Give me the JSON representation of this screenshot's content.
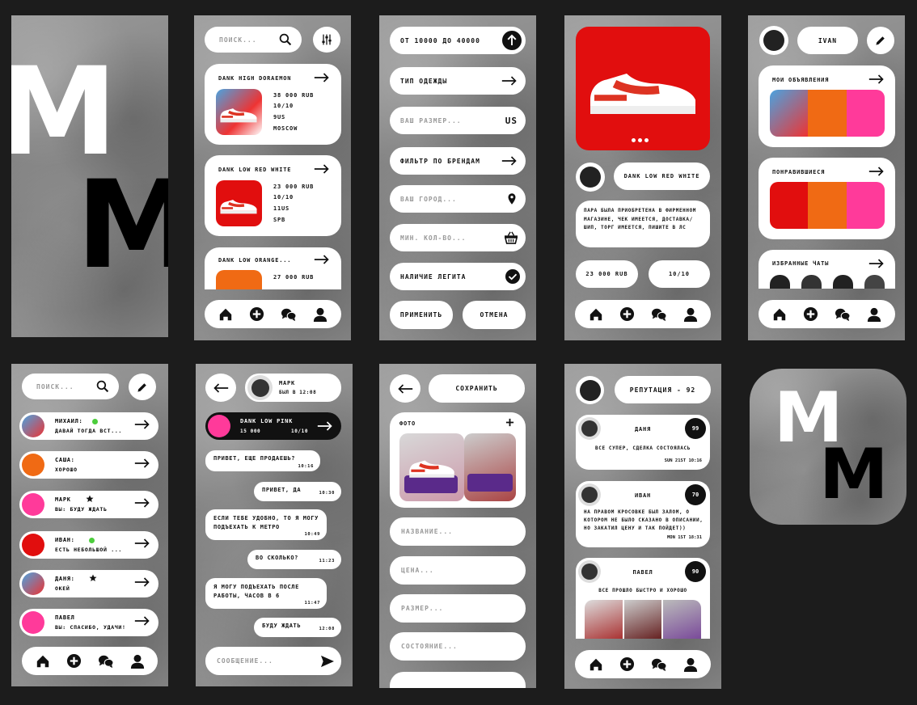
{
  "logo": {
    "letters": "M"
  },
  "search": {
    "placeholder": "поиск..."
  },
  "nav": {
    "home": "home-icon",
    "add": "plus-icon",
    "chats": "chat-icon",
    "profile": "user-icon"
  },
  "feed": {
    "items": [
      {
        "title": "DANK HIGH DORAEMON",
        "price": "38 000 RUB",
        "condition": "10/10",
        "size": "9US",
        "city": "MOSCOW"
      },
      {
        "title": "DANK LOW RED WHITE",
        "price": "23 000 RUB",
        "condition": "10/10",
        "size": "11US",
        "city": "SPB"
      },
      {
        "title": "DANK LOW ORANGE...",
        "price": "27 000 RUB"
      }
    ]
  },
  "filter": {
    "price_range": "от 10000 до 40000",
    "clothing_type": "тип одежды",
    "size_placeholder": "ваш размер...",
    "size_unit": "US",
    "brand_filter": "фильтр по брендам",
    "city_placeholder": "ваш город...",
    "qty_placeholder": "мин. кол-во...",
    "legit": "наличие легита",
    "apply": "применить",
    "cancel": "отмена"
  },
  "product": {
    "title": "DANK LOW RED WHITE",
    "description": "ПАРА БЫЛА ПРИОБРЕТЕНА В ФИРМЕННОМ МАГАЗИНЕ, ЧЕК ИМЕЕТСЯ, ДОСТАВКА/ШИП, ТОРГ ИМЕЕТСЯ, ПИШИТЕ В ЛС",
    "price": "23 000 RUB",
    "condition": "10/10"
  },
  "profile": {
    "name": "IVAN",
    "my_listings": "мои объявления",
    "liked": "понравившиеся",
    "fav_chats": "избранные чаты"
  },
  "chats": {
    "list": [
      {
        "name": "МИХАИЛ:",
        "message": "ДАВАЙ ТОГДА ВСТ...",
        "badge": "online"
      },
      {
        "name": "САША:",
        "message": "ХОРОШО",
        "badge": ""
      },
      {
        "name": "МАРК",
        "message": "ВЫ: БУДУ ЖДАТЬ",
        "badge": "star"
      },
      {
        "name": "ИВАН:",
        "message": "ЕСТЬ НЕБОЛЬШОЙ ...",
        "badge": "online"
      },
      {
        "name": "ДАНЯ:",
        "message": "ОКЕЙ",
        "badge": "star"
      },
      {
        "name": "ПАВЕЛ",
        "message": "ВЫ: СПАСИБО, УДАЧИ!",
        "badge": ""
      }
    ]
  },
  "conversation": {
    "contact": "МАРК",
    "status": "БЫЛ В 12:08",
    "pinned_title": "DANK LOW PINK",
    "pinned_price": "15 000",
    "pinned_cond": "10/10",
    "messages": [
      {
        "text": "ПРИВЕТ, ЕЩЕ ПРОДАЕШЬ?",
        "time": "10:16",
        "side": "left"
      },
      {
        "text": "ПРИВЕТ, ДА",
        "time": "10:30",
        "side": "right"
      },
      {
        "text": "ЕСЛИ ТЕБЕ УДОБНО, ТО Я МОГУ ПОДЪЕХАТЬ К МЕТРО",
        "time": "10:49",
        "side": "left"
      },
      {
        "text": "ВО СКОЛЬКО?",
        "time": "11:23",
        "side": "right"
      },
      {
        "text": "Я МОГУ ПОДЪЕХАТЬ ПОСЛЕ РАБОТЫ, ЧАСОВ В 6",
        "time": "11:47",
        "side": "left"
      },
      {
        "text": "БУДУ ЖДАТЬ",
        "time": "12:08",
        "side": "right"
      }
    ],
    "input_placeholder": "СООБЩЕНИЕ..."
  },
  "create": {
    "save": "сохранить",
    "photo": "фото",
    "name_placeholder": "название...",
    "price_placeholder": "цена...",
    "size_placeholder": "размер...",
    "state_placeholder": "состояние..."
  },
  "reputation": {
    "header": "репутация - 92",
    "reviews": [
      {
        "name": "ДАНЯ",
        "score": "99",
        "text": "ВСЕ СУПЕР, СДЕЛКА СОСТОЯЛАСЬ",
        "date": "SUN 21ST 10:16"
      },
      {
        "name": "ИВАН",
        "score": "70",
        "text": "НА ПРАВОМ КРОСОВКЕ БЫЛ ЗАЛОМ, О КОТОРОМ НЕ БЫЛО СКАЗАНО В ОПИСАНИИ, НО ЗАКАТИЛ ЦЕНУ И ТАК ПОЙДЕТ))",
        "date": "MON 1ST 18:31"
      },
      {
        "name": "ПАВЕЛ",
        "score": "90",
        "text": "ВСЕ ПРОШЛО БЫСТРО И ХОРОШО"
      }
    ]
  },
  "colors": {
    "accent_red": "#e10e0e",
    "accent_orange": "#f06a14",
    "accent_pink": "#ff3a9a",
    "online": "#4ccd3c"
  }
}
